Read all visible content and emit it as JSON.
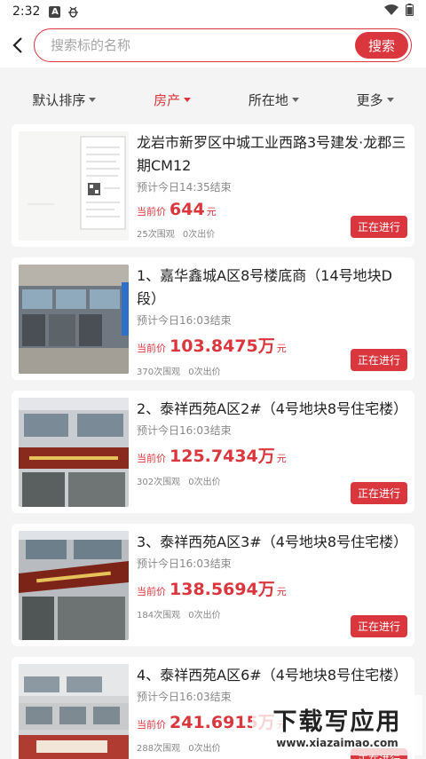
{
  "statusbar": {
    "time": "2:32"
  },
  "search": {
    "placeholder": "搜索标的名称",
    "button_label": "搜索"
  },
  "filters": [
    {
      "label": "默认排序",
      "active": false
    },
    {
      "label": "房产",
      "active": true
    },
    {
      "label": "所在地",
      "active": false
    },
    {
      "label": "更多",
      "active": false
    }
  ],
  "items": [
    {
      "title": "龙岩市新罗区中城工业西路3号建发·龙郡三期CM12",
      "end_time": "预计今日14:35结束",
      "price_label": "当前价",
      "price": "644",
      "price_unit": "元",
      "views": "25次围观",
      "bids": "0次出价",
      "status": "正在进行",
      "image": "document-image"
    },
    {
      "title": "1、嘉华鑫城A区8号楼底商（14号地块D段）",
      "end_time": "预计今日16:03结束",
      "price_label": "当前价",
      "price": "103.8475万",
      "price_unit": "元",
      "views": "370次围观",
      "bids": "0次出价",
      "status": "正在进行",
      "image": "storefront-image"
    },
    {
      "title": "2、泰祥西苑A区2#（4号地块8号住宅楼）",
      "end_time": "预计今日16:03结束",
      "price_label": "当前价",
      "price": "125.7434万",
      "price_unit": "元",
      "views": "302次围观",
      "bids": "0次出价",
      "status": "正在进行",
      "image": "building-image"
    },
    {
      "title": "3、泰祥西苑A区3#（4号地块8号住宅楼）",
      "end_time": "预计今日16:03结束",
      "price_label": "当前价",
      "price": "138.5694万",
      "price_unit": "元",
      "views": "184次围观",
      "bids": "0次出价",
      "status": "正在进行",
      "image": "building-image"
    },
    {
      "title": "4、泰祥西苑A区6#（4号地块8号住宅楼）",
      "end_time": "预计今日16:03结束",
      "price_label": "当前价",
      "price": "241.6915万",
      "price_unit": "元",
      "views": "288次围观",
      "bids": "0次出价",
      "status": "正在进行",
      "image": "building-image"
    }
  ],
  "watermark": {
    "line1": "下载写应用",
    "line2": "www.xiazaimao.com"
  },
  "colors": {
    "accent": "#d9363e",
    "background": "#f4f4f4"
  }
}
